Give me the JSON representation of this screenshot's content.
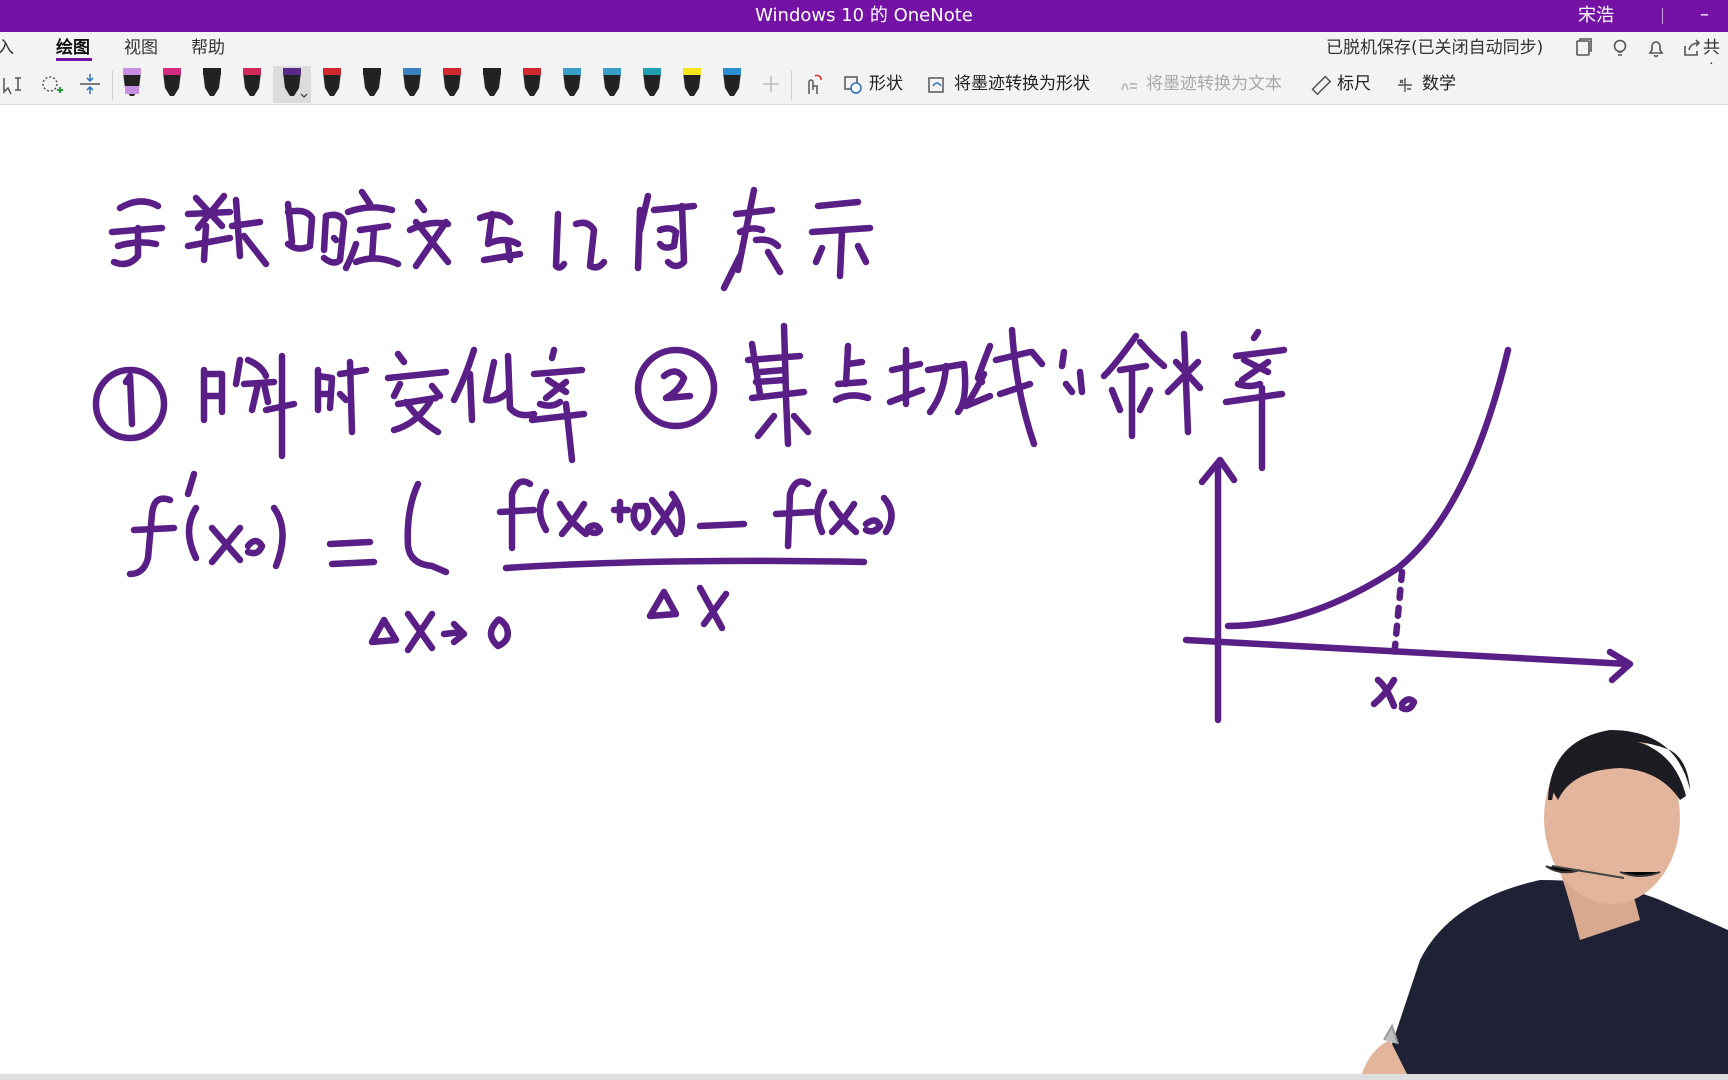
{
  "window": {
    "title": "Windows 10 的 OneNote",
    "user": "宋浩",
    "minimize": "–"
  },
  "menu": {
    "tabs": [
      "插入",
      "绘图",
      "视图",
      "帮助"
    ],
    "active_tab": "绘图",
    "sync_status": "已脱机保存(已关闭自动同步)",
    "share": "共享"
  },
  "toolbar": {
    "commands": {
      "shapes": "形状",
      "ink_to_shape": "将墨迹转换为形状",
      "ink_to_text": "将墨迹转换为文本",
      "ruler": "标尺",
      "math": "数学"
    },
    "pen_colors": [
      "#c68de0",
      "#d42a7e",
      "#222222",
      "#d0285a",
      "#5a2a8a",
      "#d0282e",
      "#222222",
      "#3a7fbf",
      "#d0282e",
      "#222222",
      "#d0282e",
      "#3aa0c8",
      "#3aa0c8",
      "#1f9fb0",
      "#f5e61c",
      "#2a8fd0"
    ],
    "accent": "#7412a6"
  },
  "ink": {
    "color": "#5a1f86",
    "tick_label": "x₀"
  }
}
